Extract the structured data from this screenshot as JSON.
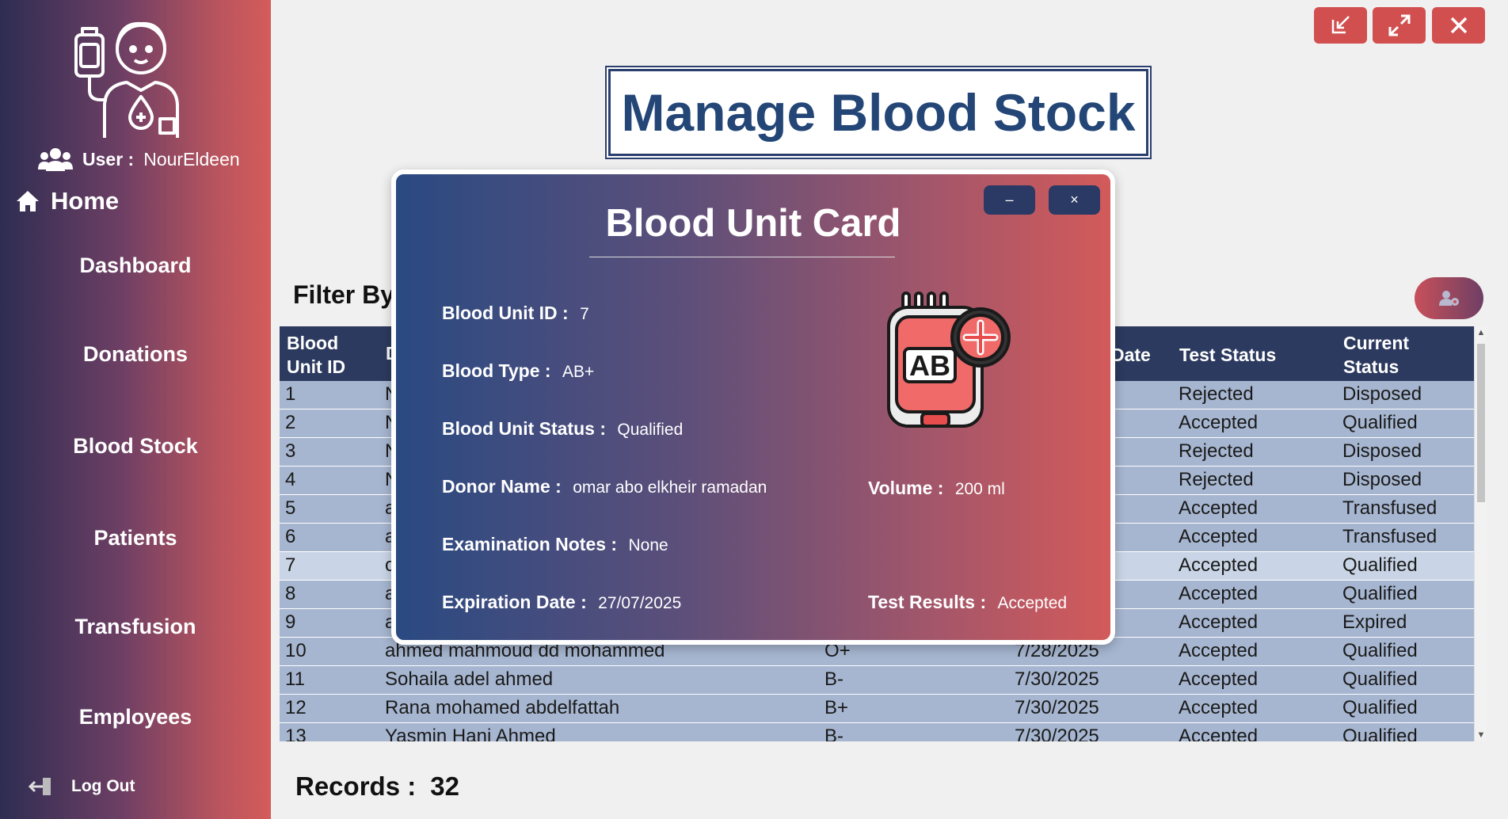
{
  "sidebar": {
    "user_label": "User :",
    "user_name": "NourEldeen",
    "home": "Home",
    "nav": [
      "Dashboard",
      "Donations",
      "Blood Stock",
      "Patients",
      "Transfusion",
      "Employees"
    ],
    "logout": "Log Out"
  },
  "window": {
    "minimize_icon": "minimize-to-corner-icon",
    "maximize_icon": "expand-icon",
    "close_icon": "close-icon",
    "accent": "#d24f4f"
  },
  "page": {
    "title": "Manage Blood Stock",
    "filter_label": "Filter  By",
    "records_label": "Records :",
    "records_count": "32"
  },
  "grid": {
    "headers": [
      "Blood\nUnit ID",
      "D",
      "",
      "Date",
      "Test Status",
      "Current\nStatus"
    ],
    "rows": [
      [
        "1",
        "N",
        "",
        "",
        "Rejected",
        "Disposed"
      ],
      [
        "2",
        "N",
        "",
        "",
        "Accepted",
        "Qualified"
      ],
      [
        "3",
        "N",
        "",
        "",
        "Rejected",
        "Disposed"
      ],
      [
        "4",
        "N",
        "",
        "",
        "Rejected",
        "Disposed"
      ],
      [
        "5",
        "a",
        "",
        "",
        "Accepted",
        "Transfused"
      ],
      [
        "6",
        "a",
        "",
        "",
        "Accepted",
        "Transfused"
      ],
      [
        "7",
        "o",
        "",
        "",
        "Accepted",
        "Qualified"
      ],
      [
        "8",
        "a",
        "",
        "",
        "Accepted",
        "Qualified"
      ],
      [
        "9",
        "a",
        "",
        "",
        "Accepted",
        "Expired"
      ],
      [
        "10",
        "ahmed mahmoud dd mohammed",
        "O+",
        "7/28/2025",
        "Accepted",
        "Qualified"
      ],
      [
        "11",
        "Sohaila adel  ahmed",
        "B-",
        "7/30/2025",
        "Accepted",
        "Qualified"
      ],
      [
        "12",
        "Rana mohamed  abdelfattah",
        "B+",
        "7/30/2025",
        "Accepted",
        "Qualified"
      ],
      [
        "13",
        "Yasmin Hani  Ahmed",
        "B-",
        "7/30/2025",
        "Accepted",
        "Qualified"
      ]
    ],
    "selected_row": 6,
    "colors": {
      "header": "#2c3a5f",
      "row": "#a6b6d0",
      "selected": "#c9d5e6"
    }
  },
  "card": {
    "title": "Blood Unit Card",
    "minimize": "–",
    "close": "×",
    "unit_id_label": "Blood Unit ID :",
    "unit_id": "7",
    "type_label": "Blood Type :",
    "type": "AB+",
    "status_label": "Blood Unit Status :",
    "status": "Qualified",
    "donor_label": "Donor Name :",
    "donor": "omar abo elkheir ramadan",
    "notes_label": "Examination Notes :",
    "notes": "None",
    "expiry_label": "Expiration Date :",
    "expiry": "27/07/2025",
    "volume_label": "Volume :",
    "volume": "200 ml",
    "results_label": "Test Results :",
    "results": "Accepted",
    "bag_text": "AB",
    "bag_icon": "blood-bag-icon"
  }
}
